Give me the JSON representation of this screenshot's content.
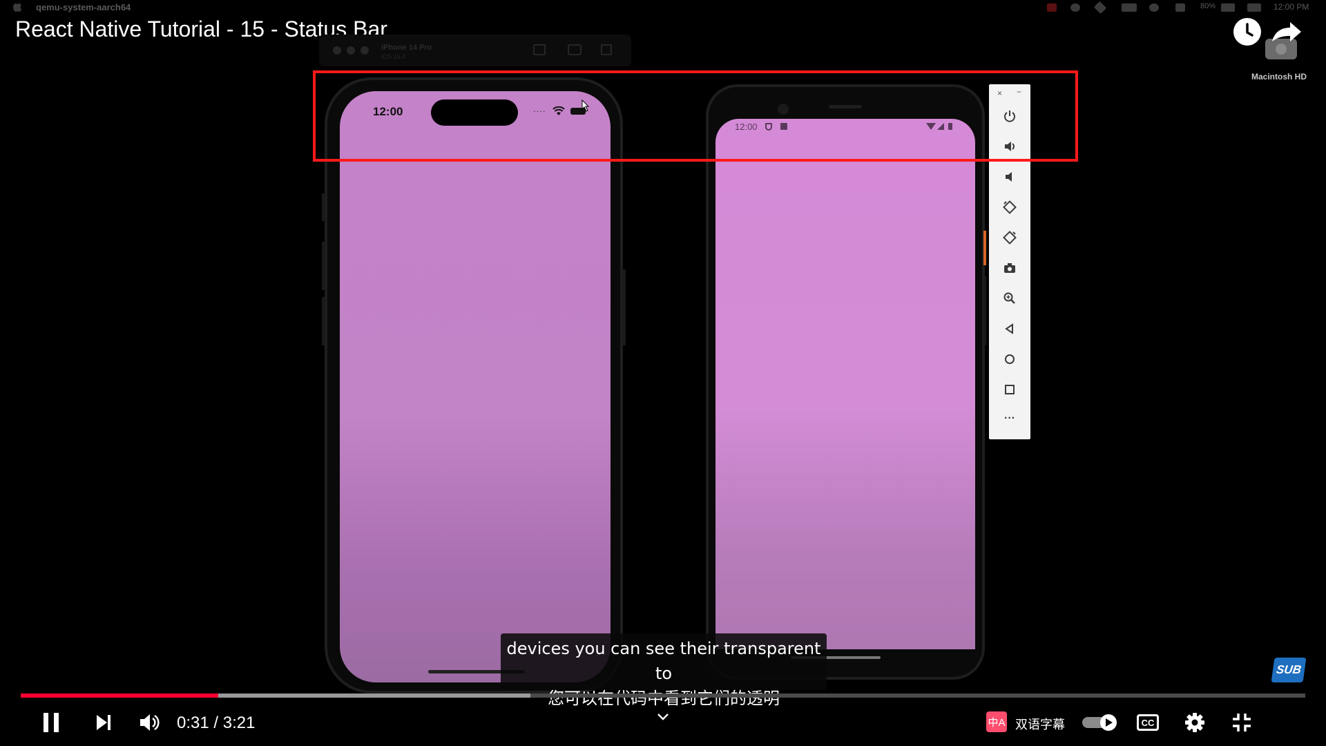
{
  "menubar": {
    "app_name": "qemu-system-aarch64",
    "clock": "12:00 PM",
    "battery": "80%"
  },
  "video": {
    "title": "React Native Tutorial - 15 - Status Bar",
    "current_time": "0:31",
    "separator": " / ",
    "duration": "3:21",
    "progress_played": 0.154,
    "progress_buffered": 0.397
  },
  "desktop": {
    "drive_label": "Macintosh HD"
  },
  "simulator": {
    "device_name": "iPhone 14 Pro",
    "os_version": "iOS 16.4"
  },
  "iphone": {
    "time": "12:00",
    "signal_dots": "....",
    "screen_color": "#c482c8"
  },
  "android": {
    "time": "12:00",
    "screen_color": "#d48ad6"
  },
  "emulator_toolbar": {
    "close": "×",
    "minimize": "−",
    "more": "···"
  },
  "subtitle": {
    "line_en": "devices you can see their transparent to",
    "line_zh": "您可以在代码中看到它们的透明"
  },
  "controls": {
    "bilingual_icon_text": "中A",
    "bilingual_label": "双语字幕",
    "cc_label": "CC",
    "sub_badge": "SUB"
  },
  "colors": {
    "highlight": "#ff1a1a",
    "progress_played": "#ff0033"
  }
}
